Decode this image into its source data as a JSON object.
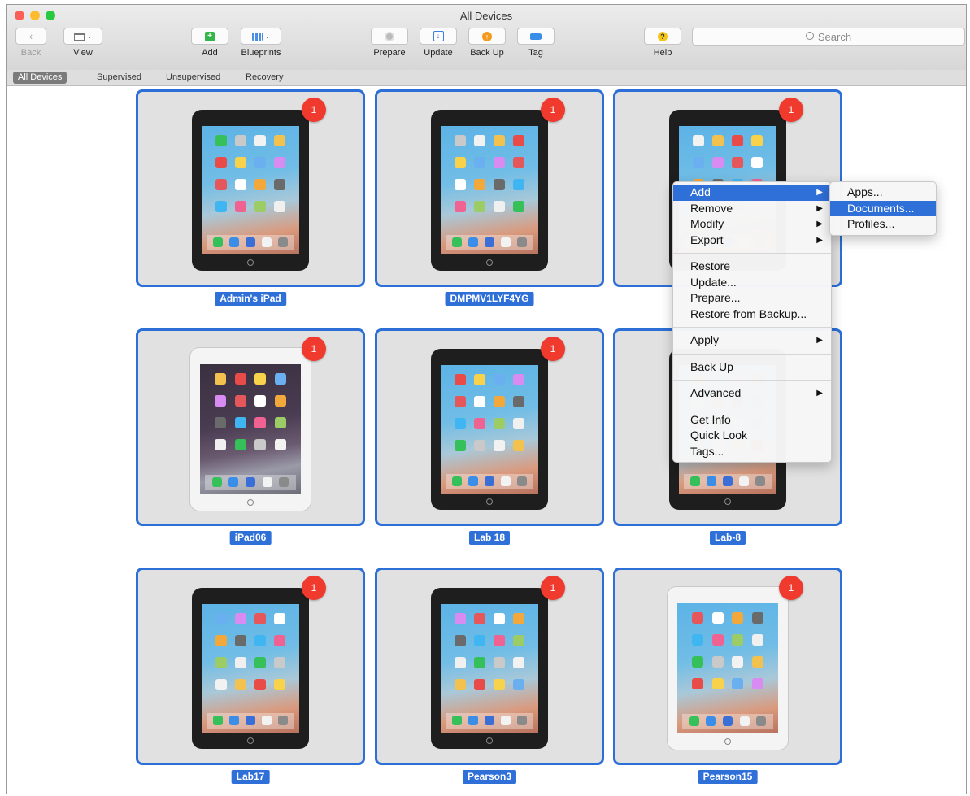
{
  "window": {
    "title": "All Devices"
  },
  "toolbar": {
    "back_label": "Back",
    "view_label": "View",
    "add_label": "Add",
    "blueprints_label": "Blueprints",
    "prepare_label": "Prepare",
    "update_label": "Update",
    "backup_label": "Back Up",
    "tag_label": "Tag",
    "help_label": "Help",
    "search_placeholder": "Search"
  },
  "tabs": [
    "All Devices",
    "Supervised",
    "Unsupervised",
    "Recovery"
  ],
  "active_tab": "All Devices",
  "devices": [
    {
      "name": "Admin's iPad",
      "badge": "1",
      "style": "black"
    },
    {
      "name": "DMPMV1LYF4YG",
      "badge": "1",
      "style": "black"
    },
    {
      "name": "",
      "badge": "1",
      "style": "black"
    },
    {
      "name": "iPad06",
      "badge": "1",
      "style": "white"
    },
    {
      "name": "Lab 18",
      "badge": "1",
      "style": "black"
    },
    {
      "name": "Lab-8",
      "badge": "",
      "style": "black"
    },
    {
      "name": "Lab17",
      "badge": "1",
      "style": "black"
    },
    {
      "name": "Pearson3",
      "badge": "1",
      "style": "black"
    },
    {
      "name": "Pearson15",
      "badge": "1",
      "style": "white"
    }
  ],
  "context_menu": {
    "items": [
      {
        "label": "Add",
        "submenu": true,
        "highlighted": true
      },
      {
        "label": "Remove",
        "submenu": true
      },
      {
        "label": "Modify",
        "submenu": true
      },
      {
        "label": "Export",
        "submenu": true
      },
      {
        "separator": true
      },
      {
        "label": "Restore"
      },
      {
        "label": "Update..."
      },
      {
        "label": "Prepare..."
      },
      {
        "label": "Restore from Backup..."
      },
      {
        "separator": true
      },
      {
        "label": "Apply",
        "submenu": true
      },
      {
        "separator": true
      },
      {
        "label": "Back Up"
      },
      {
        "separator": true
      },
      {
        "label": "Advanced",
        "submenu": true
      },
      {
        "separator": true
      },
      {
        "label": "Get Info"
      },
      {
        "label": "Quick Look"
      },
      {
        "label": "Tags..."
      }
    ]
  },
  "submenu": {
    "items": [
      {
        "label": "Apps..."
      },
      {
        "label": "Documents...",
        "highlighted": true
      },
      {
        "label": "Profiles..."
      }
    ]
  },
  "colors": {
    "selection": "#2f6fd8",
    "badge": "#f03a2e",
    "tile_bg": "#e1e1e1"
  }
}
